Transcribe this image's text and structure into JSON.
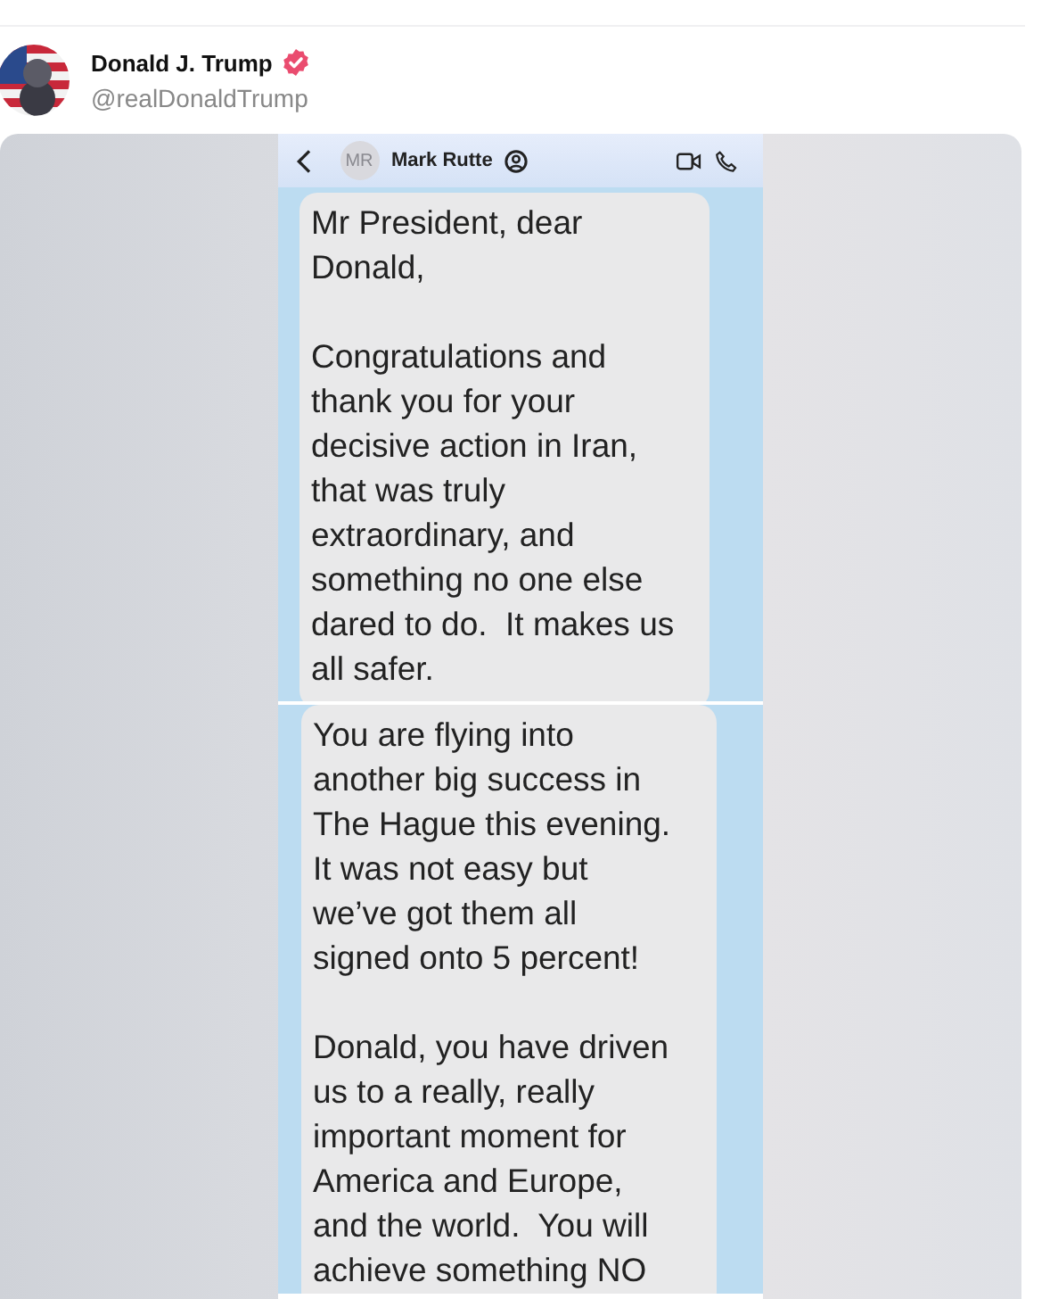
{
  "post": {
    "author": {
      "name": "Donald J. Trump",
      "verified": true,
      "handle": "@realDonaldTrump"
    },
    "screenshots": [
      {
        "contact": {
          "initials": "MR",
          "name": "Mark Rutte"
        },
        "paragraphs": [
          "Mr President, dear\nDonald,",
          "Congratulations and\nthank you for your\ndecisive action in Iran,\nthat was truly\nextraordinary, and\nsomething no one else\ndared to do.  It makes us\nall safer."
        ]
      },
      {
        "paragraphs": [
          "You are flying into\nanother big success in\nThe Hague this evening.\nIt was not easy but\nwe’ve got them all\nsigned onto 5 percent!",
          "Donald, you have driven\nus to a really, really\nimportant moment for\nAmerica and Europe,\nand the world.  You will\nachieve something NO"
        ]
      }
    ]
  }
}
